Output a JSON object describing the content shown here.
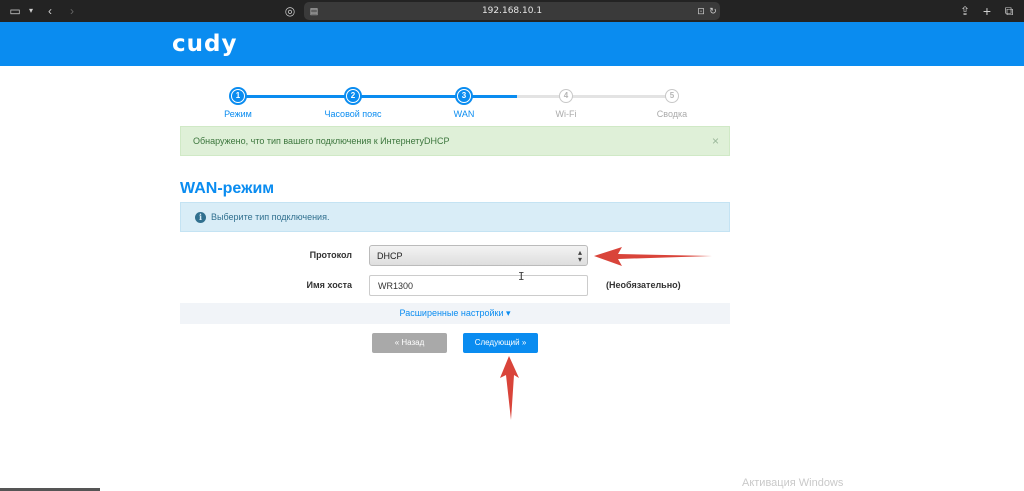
{
  "browser": {
    "address": "192.168.10.1"
  },
  "header": {
    "logo": "cudy"
  },
  "stepper": {
    "steps": [
      {
        "number": "1",
        "label": "Режим"
      },
      {
        "number": "2",
        "label": "Часовой пояс"
      },
      {
        "number": "3",
        "label": "WAN"
      },
      {
        "number": "4",
        "label": "Wi-Fi"
      },
      {
        "number": "5",
        "label": "Сводка"
      }
    ],
    "current": 3
  },
  "alert_success": {
    "text": "Обнаружено, что тип вашего подключения к ИнтернетуDHCP",
    "close": "×"
  },
  "section": {
    "title": "WAN-режим"
  },
  "alert_info": {
    "icon": "i",
    "text": "Выберите тип подключения."
  },
  "form": {
    "protocol_label": "Протокол",
    "protocol_value": "DHCP",
    "hostname_label": "Имя хоста",
    "hostname_value": "WR1300",
    "hostname_note": "(Необязательно)"
  },
  "advanced": {
    "label": "Расширенные настройки ▾"
  },
  "buttons": {
    "back": "« Назад",
    "next": "Следующий »"
  },
  "watermark": "Активация Windows",
  "colors": {
    "brand": "#0a8cf0",
    "arrow": "#d9443a"
  }
}
